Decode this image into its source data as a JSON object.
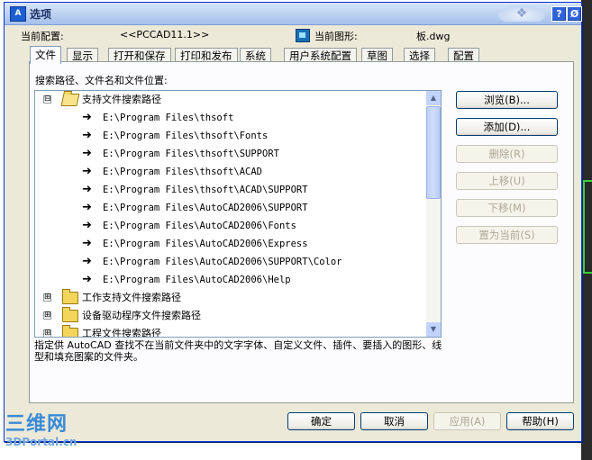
{
  "window": {
    "title": "选项",
    "icon": "A",
    "help_symbol": "?",
    "close_symbol": "Ø"
  },
  "header": {
    "current_profile_label": "当前配置:",
    "current_profile_value": "<<PCCAD11.1>>",
    "current_drawing_label": "当前图形:",
    "current_drawing_value": "板.dwg"
  },
  "tabs": [
    {
      "label": "文件",
      "active": true
    },
    {
      "label": "显示"
    },
    {
      "label": "打开和保存"
    },
    {
      "label": "打印和发布"
    },
    {
      "label": "系统"
    },
    {
      "label": "用户系统配置"
    },
    {
      "label": "草图"
    },
    {
      "label": "选择"
    },
    {
      "label": "配置"
    }
  ],
  "panel": {
    "caption": "搜索路径、文件名和文件位置:",
    "tree": {
      "root": {
        "label": "支持文件搜索路径",
        "expander": "⊟",
        "expanded": true
      },
      "paths": [
        "E:\\Program Files\\thsoft",
        "E:\\Program Files\\thsoft\\Fonts",
        "E:\\Program Files\\thsoft\\SUPPORT",
        "E:\\Program Files\\thsoft\\ACAD",
        "E:\\Program Files\\thsoft\\ACAD\\SUPPORT",
        "E:\\Program Files\\AutoCAD2006\\SUPPORT",
        "E:\\Program Files\\AutoCAD2006\\Fonts",
        "E:\\Program Files\\AutoCAD2006\\Express",
        "E:\\Program Files\\AutoCAD2006\\SUPPORT\\Color",
        "E:\\Program Files\\AutoCAD2006\\Help"
      ],
      "collapsed": [
        {
          "label": "工作支持文件搜索路径",
          "expander": "⊞"
        },
        {
          "label": "设备驱动程序文件搜索路径",
          "expander": "⊞"
        },
        {
          "label": "工程文件搜索路径",
          "expander": "⊞"
        }
      ]
    },
    "description": "指定供 AutoCAD 查找不在当前文件夹中的文字字体、自定义文件、插件、要插入的图形、线型和填充图案的文件夹。",
    "side_buttons": [
      {
        "label": "浏览(B)...",
        "enabled": true
      },
      {
        "label": "添加(D)...",
        "enabled": true
      },
      {
        "label": "删除(R)",
        "enabled": false
      },
      {
        "label": "上移(U)",
        "enabled": false
      },
      {
        "label": "下移(M)",
        "enabled": false
      },
      {
        "label": "置为当前(S)",
        "enabled": false
      }
    ]
  },
  "footer": {
    "ok": "确定",
    "cancel": "取消",
    "apply": "应用(A)",
    "help": "帮助(H)"
  },
  "watermark": {
    "logo": "三维网",
    "site": "3DPortal.cn"
  },
  "icons": {
    "path_arrow": "➜",
    "scroll_up": "▲",
    "scroll_down": "▼"
  },
  "colors": {
    "title_blue": "#0831d9",
    "dialog_bg": "#ece9d8",
    "watermark_blue": "#3a8bd7"
  }
}
